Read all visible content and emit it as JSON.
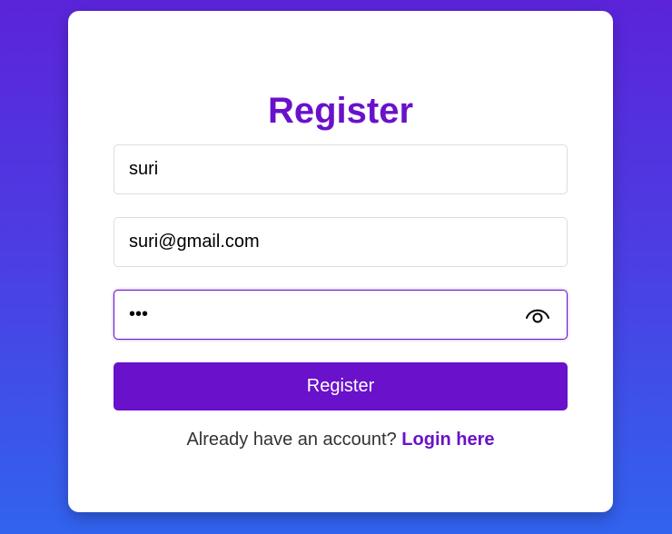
{
  "form": {
    "title": "Register",
    "username_value": "suri",
    "email_value": "suri@gmail.com",
    "password_value": "abc",
    "password_icon": "eye-icon",
    "submit_label": "Register"
  },
  "footer": {
    "prompt": "Already have an account?",
    "link_label": "Login here"
  },
  "colors": {
    "accent": "#6a11cb",
    "background_top": "#5b24d9",
    "background_bottom": "#3163ee"
  }
}
